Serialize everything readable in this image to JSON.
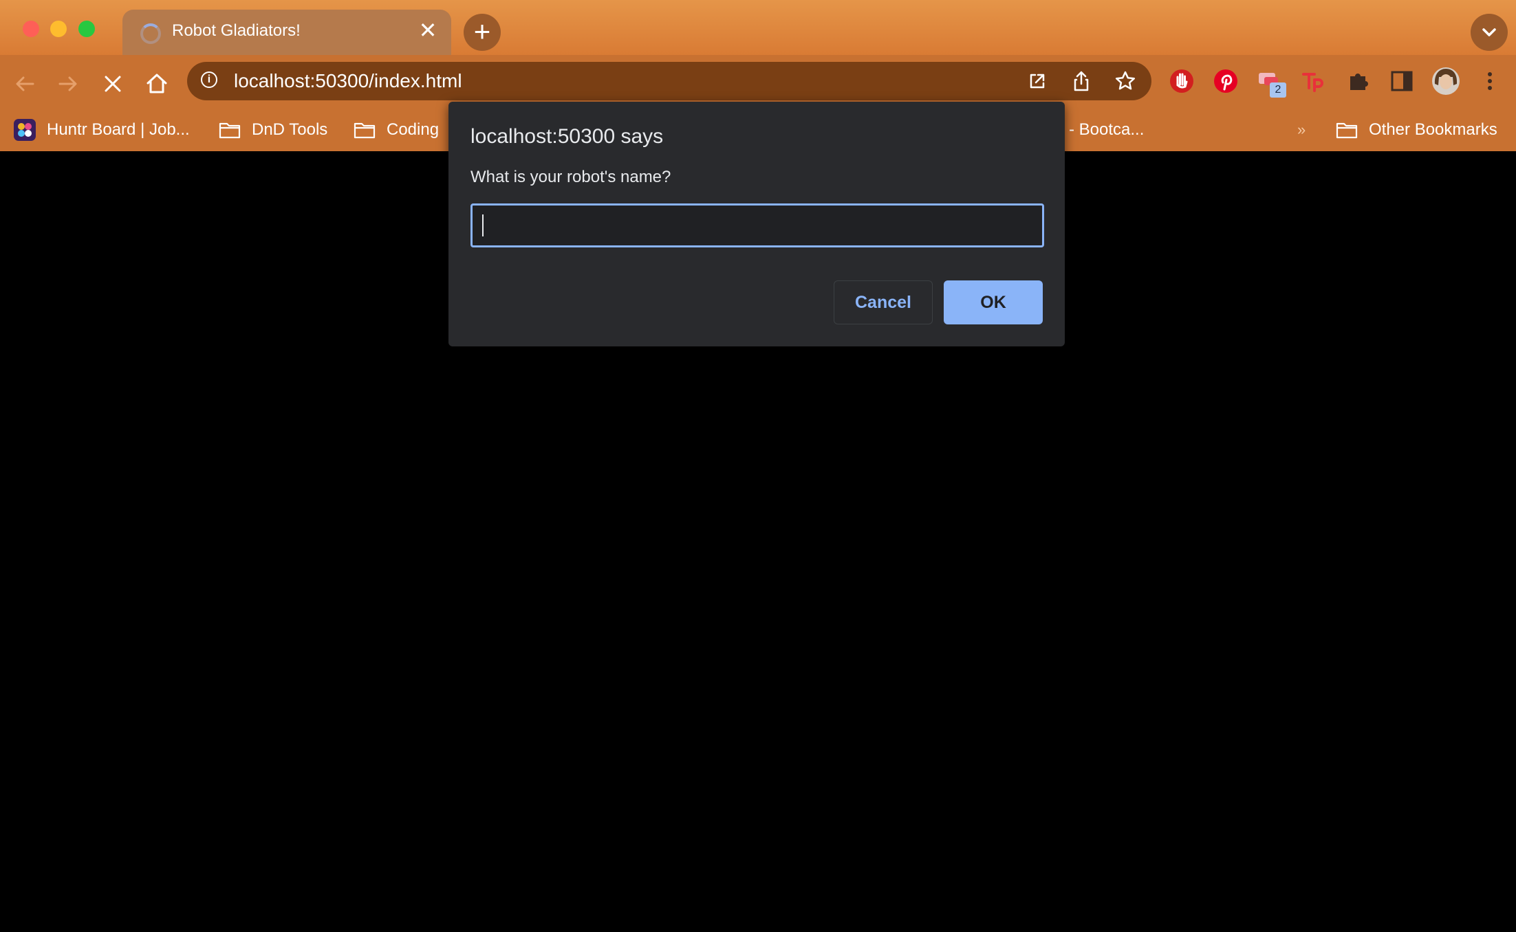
{
  "tabs": [
    {
      "title": "Robot Gladiators!",
      "close_glyph": "✕",
      "loading": true
    }
  ],
  "new_tab_glyph": "+",
  "address_bar": {
    "url": "localhost:50300/index.html",
    "info_glyph": "i"
  },
  "bookmarks": {
    "items": [
      {
        "label": "Huntr Board | Job...",
        "icon": "huntr-logo-icon"
      },
      {
        "label": "DnD Tools",
        "icon": "folder-icon"
      },
      {
        "label": "Coding",
        "icon": "folder-icon"
      },
      {
        "label": "- Bootca...",
        "icon": "none"
      }
    ],
    "overflow_glyph": "»",
    "other": "Other Bookmarks"
  },
  "extensions": {
    "badge_count": "2"
  },
  "dialog": {
    "title": "localhost:50300 says",
    "message": "What is your robot's name?",
    "input_value": "",
    "cancel_label": "Cancel",
    "ok_label": "OK"
  },
  "colors": {
    "chrome_top": "#e59549",
    "toolbar": "#c87131",
    "omnibox": "#7a3f14",
    "dialog_bg": "#292a2d",
    "accent": "#8ab4f8",
    "page_bg": "#000000"
  }
}
